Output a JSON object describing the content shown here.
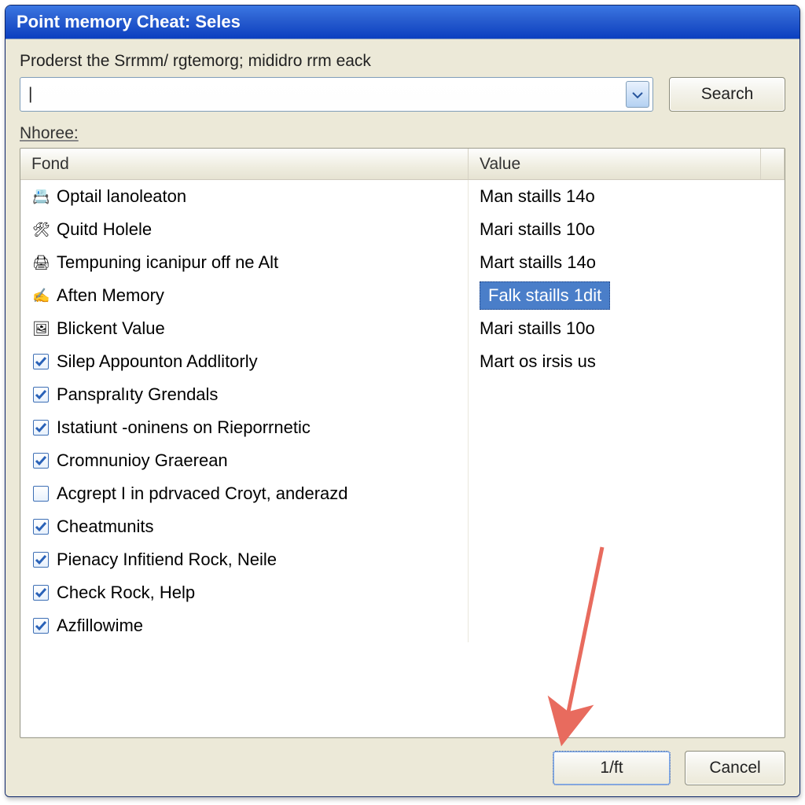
{
  "window": {
    "title": "Point memory Cheat: Seles"
  },
  "prompt_label": "Proderst the Srrmm/ rgtemorg; mididro rrm eack",
  "search": {
    "value": "",
    "placeholder": "",
    "button_label": "Search",
    "caret_glyph": "|"
  },
  "sub_label": "Nhoree:",
  "columns": {
    "fond": "Fond",
    "value": "Value"
  },
  "rows": [
    {
      "icon": "app-blue-icon",
      "checkbox": null,
      "label": "Optail lanoleaton",
      "value": "Man staills 14o",
      "selected": false
    },
    {
      "icon": "tool-icon",
      "checkbox": null,
      "label": "Quitd Holele",
      "value": "Mari staills 10o",
      "selected": false
    },
    {
      "icon": "printer-icon",
      "checkbox": null,
      "label": "Tempuning icanipur off ne Alt",
      "value": "Mart staills 14o",
      "selected": false
    },
    {
      "icon": "hand-icon",
      "checkbox": null,
      "label": "Aften Memory",
      "value": "Falk staills 1dit",
      "selected": true
    },
    {
      "icon": "picture-icon",
      "checkbox": null,
      "label": "Blickent Value",
      "value": "Mari staills 10o",
      "selected": false
    },
    {
      "icon": null,
      "checkbox": true,
      "label": "Silep Appounton Addlitorly",
      "value": "Mart os irsis us",
      "selected": false
    },
    {
      "icon": null,
      "checkbox": true,
      "label": "Panspralıty Grendals",
      "value": "",
      "selected": false
    },
    {
      "icon": null,
      "checkbox": true,
      "label": "Istatiunt -oninens on Rieporrnetic",
      "value": "",
      "selected": false
    },
    {
      "icon": null,
      "checkbox": true,
      "label": "Cromnunioy Graerean",
      "value": "",
      "selected": false
    },
    {
      "icon": null,
      "checkbox": false,
      "label": "Acgrept I in pdrvaced Croyt, anderazd",
      "value": "",
      "selected": false
    },
    {
      "icon": null,
      "checkbox": true,
      "label": "Cheatmunits",
      "value": "",
      "selected": false
    },
    {
      "icon": null,
      "checkbox": true,
      "label": "Pienacy Infitiend Rock, Neile",
      "value": "",
      "selected": false
    },
    {
      "icon": null,
      "checkbox": true,
      "label": "Check Rock, Help",
      "value": "",
      "selected": false
    },
    {
      "icon": null,
      "checkbox": true,
      "label": "Azfillowime",
      "value": "",
      "selected": false
    }
  ],
  "footer": {
    "ok_label": "1/ft",
    "cancel_label": "Cancel"
  },
  "colors": {
    "title_gradient_top": "#3b77e3",
    "title_gradient_bottom": "#0b3fc0",
    "panel_bg": "#ece9d8",
    "selection_bg": "#4a7ec9",
    "arrow": "#e86b5e"
  },
  "icons": {
    "app-blue-icon": "📇",
    "tool-icon": "🛠",
    "printer-icon": "🖨",
    "hand-icon": "✍",
    "picture-icon": "🖼"
  }
}
